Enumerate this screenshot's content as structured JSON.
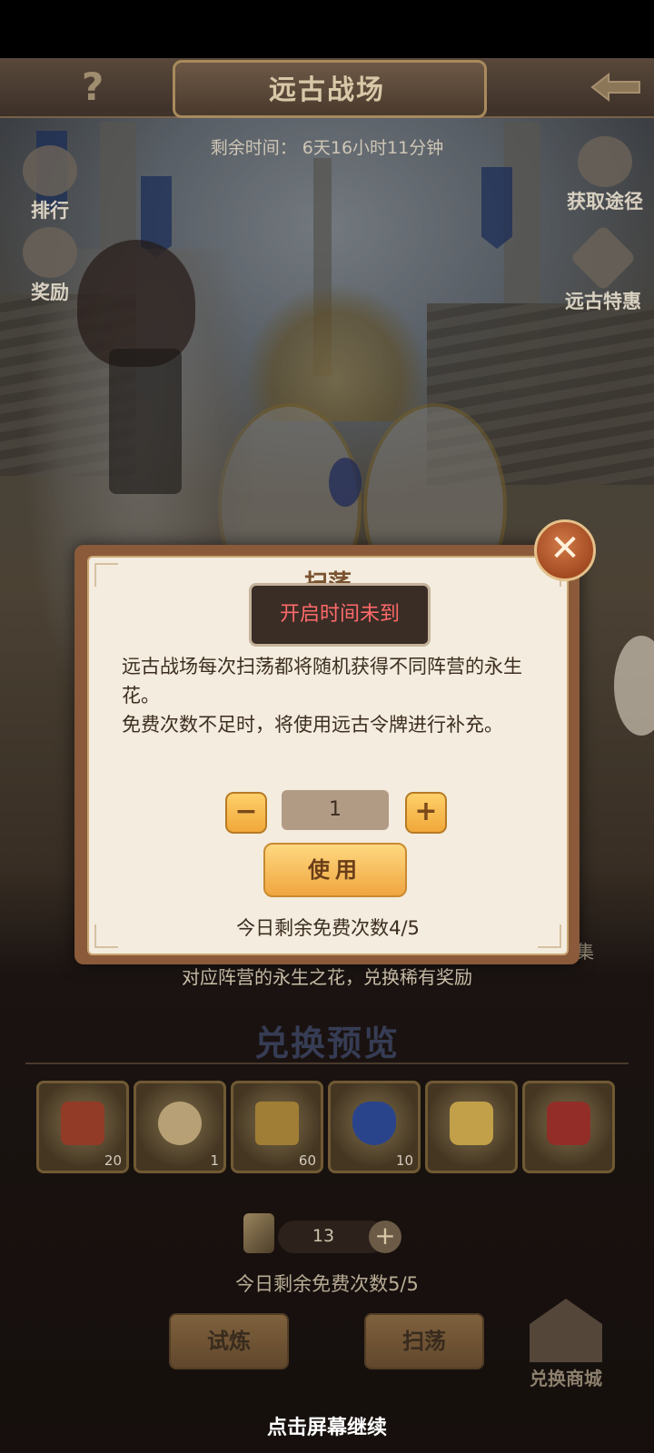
{
  "header": {
    "title": "远古战场",
    "help_icon_text": "?",
    "timer_text": "剩余时间：  6天16小时11分钟"
  },
  "side_left": [
    {
      "label": "排行"
    },
    {
      "label": "奖励"
    }
  ],
  "side_right": [
    {
      "label": "获取途径"
    },
    {
      "label": "远古特惠"
    }
  ],
  "dialog": {
    "title": "扫荡",
    "toast": "开启时间未到",
    "body_line1": "远古战场每次扫荡都将随机获得不同阵营的永生花。",
    "body_line2": "免费次数不足时，将使用远古令牌进行补充。",
    "quantity": "1",
    "minus_label": "−",
    "plus_label": "+",
    "use_button": "使用",
    "free_remaining": "今日剩余免费次数4/5",
    "close_label": "✕"
  },
  "main": {
    "description_tail": "集",
    "description": "对应阵营的永生之花，兑换稀有奖励",
    "preview_title": "兑换预览",
    "items": [
      {
        "count": "20"
      },
      {
        "count": "1"
      },
      {
        "count": "60"
      },
      {
        "count": "10"
      },
      {
        "count": ""
      },
      {
        "count": ""
      }
    ],
    "token_count": "13",
    "token_plus": "+",
    "free_remaining": "今日剩余免费次数5/5",
    "trial_button": "试炼",
    "sweep_button": "扫荡",
    "shop_label": "兑换商城",
    "continue_hint": "点击屏幕继续"
  }
}
